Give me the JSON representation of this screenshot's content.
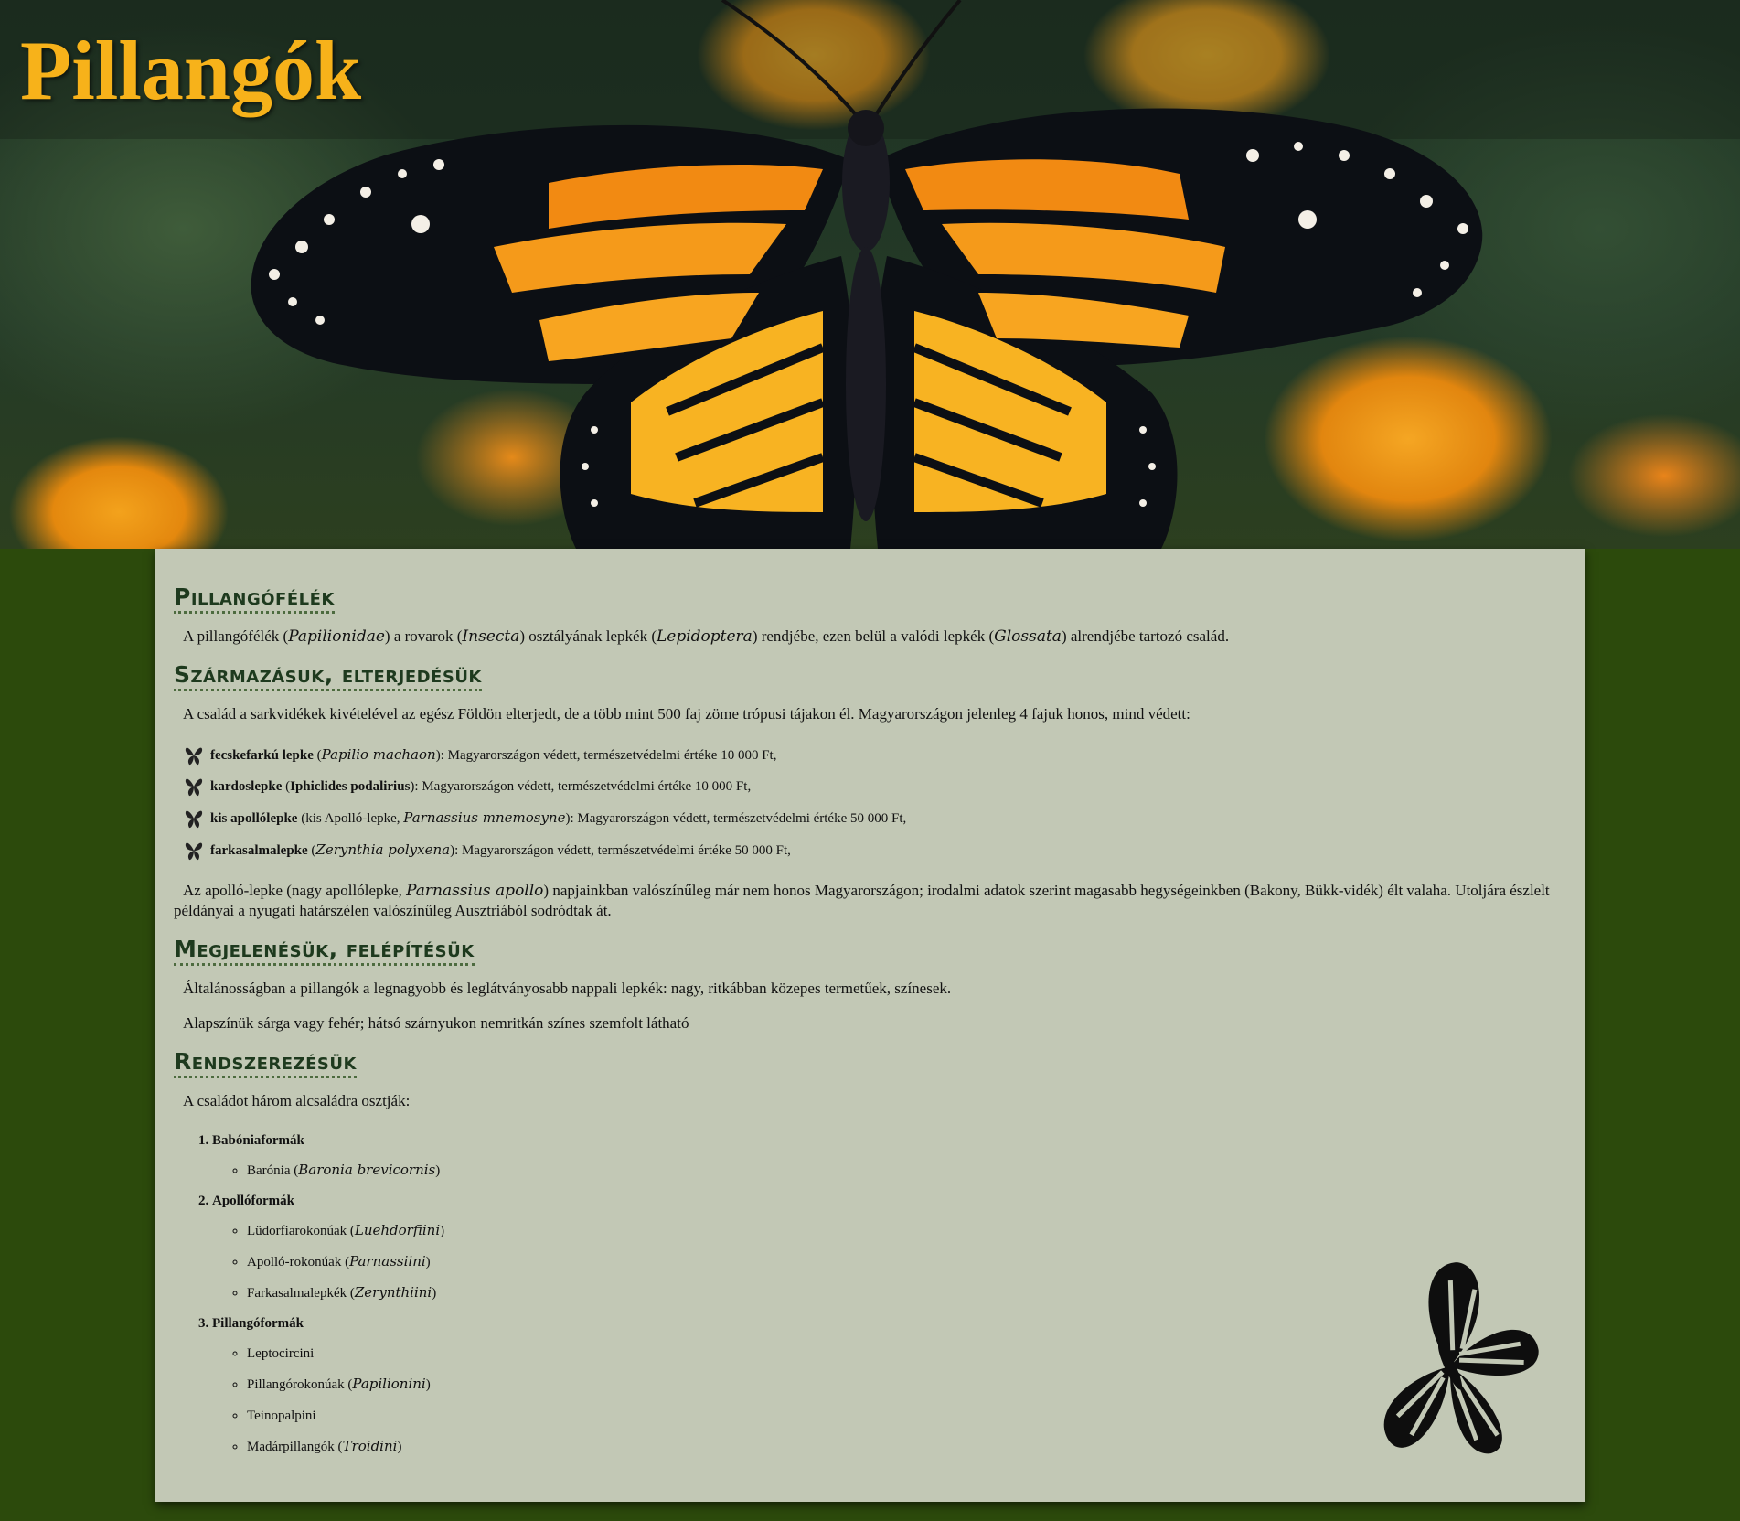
{
  "header": {
    "title": "Pillangók"
  },
  "sections": {
    "intro": {
      "heading": "Pillangófélék",
      "p": {
        "t1": "A pillangófélék (",
        "i1": "Papilionidae",
        "t2": ") a rovarok (",
        "i2": "Insecta",
        "t3": ") osztályának lepkék (",
        "i3": "Lepidoptera",
        "t4": ") rendjébe, ezen belül a valódi lepkék (",
        "i4": "Glossata",
        "t5": ") alrendjébe tartozó család."
      }
    },
    "origin": {
      "heading": "Származásuk, elterjedésük",
      "p1": "A család a sarkvidékek kivételével az egész Földön elterjedt, de a több mint 500 faj zöme trópusi tájakon él. Magyarországon jelenleg 4 fajuk honos, mind védett:",
      "species": [
        {
          "name": "fecskefarkú lepke",
          "open": " (",
          "latin": "Papilio machaon",
          "rest": "): Magyarországon védett, természetvédelmi értéke 10 000 Ft,"
        },
        {
          "name": "kardoslepke",
          "open": " (",
          "bold_latin": "Iphiclides podalirius",
          "rest": "): Magyarországon védett, természetvédelmi értéke 10 000 Ft,"
        },
        {
          "name": "kis apollólepke",
          "open": " (kis Apolló-lepke, ",
          "latin": "Parnassius mnemosyne",
          "rest": "): Magyarországon védett, természetvédelmi értéke 50 000 Ft,"
        },
        {
          "name": "farkasalmalepke",
          "open": " (",
          "latin": "Zerynthia polyxena",
          "rest": "): Magyarországon védett, természetvédelmi értéke 50 000 Ft,"
        }
      ],
      "p2": {
        "t1": "Az apolló-lepke (nagy apollólepke, ",
        "i1": "Parnassius apollo",
        "t2": ") napjainkban valószínűleg már nem honos Magyarországon; irodalmi adatok szerint magasabb hegységeinkben (Bakony, Bükk-vidék) élt valaha. Utoljára észlelt példányai a nyugati határszélen valószínűleg Ausztriából sodródtak át."
      }
    },
    "appearance": {
      "heading": "Megjelenésük, felépítésük",
      "p1": "Általánosságban a pillangók a legnagyobb és leglátványosabb nappali lepkék: nagy, ritkábban közepes termetűek, színesek.",
      "p2": "Alapszínük sárga vagy fehér; hátsó szárnyukon nemritkán színes szemfolt látható"
    },
    "taxonomy": {
      "heading": "Rendszerezésük",
      "p1": "A családot három alcsaládra osztják:",
      "subfamilies": [
        {
          "name": "Babóniaformák",
          "items": [
            {
              "text": "Barónia (",
              "latin": "Baronia brevicornis",
              "close": ")"
            }
          ]
        },
        {
          "name": "Apollóformák",
          "items": [
            {
              "text": "Lüdorfiarokonúak (",
              "latin": "Luehdorfiini",
              "close": ")"
            },
            {
              "text": "Apolló-rokonúak (",
              "latin": "Parnassiini",
              "close": ")"
            },
            {
              "text": "Farkasalmalepkék (",
              "latin": "Zerynthiini",
              "close": ")"
            }
          ]
        },
        {
          "name": "Pillangóformák",
          "items": [
            {
              "text": "Leptocircini",
              "latin": "",
              "close": ""
            },
            {
              "text": "Pillangórokonúak (",
              "latin": "Papilionini",
              "close": ")"
            },
            {
              "text": "Teinopalpini",
              "latin": "",
              "close": ""
            },
            {
              "text": "Madárpillangók (",
              "latin": "Troidini",
              "close": ")"
            }
          ]
        }
      ]
    }
  },
  "colors": {
    "background": "#2c4a0c",
    "panel": "#c2c8b5",
    "title": "#f7b21a",
    "heading": "#1e3a1e"
  },
  "icons": {
    "hero": "monarch-butterfly-image",
    "bullet": "butterfly-icon",
    "corner": "butterfly-silhouette-icon"
  }
}
